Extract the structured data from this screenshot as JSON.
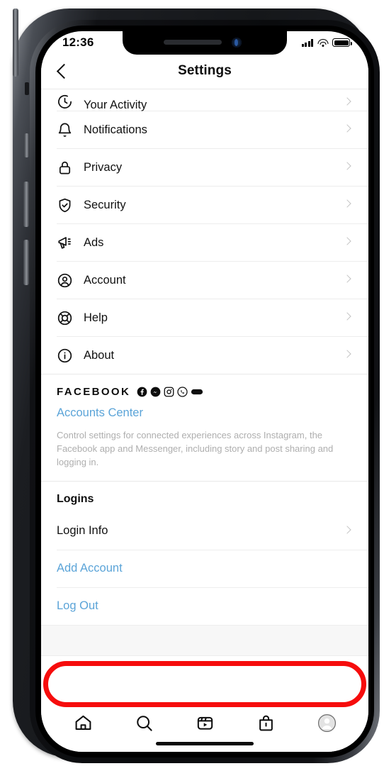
{
  "status_bar": {
    "time": "12:36",
    "signal_icon": "cellular-signal-icon",
    "wifi_icon": "wifi-icon",
    "battery_icon": "battery-icon"
  },
  "header": {
    "back_icon": "back-chevron-icon",
    "title": "Settings"
  },
  "settings_list": [
    {
      "label": "Your Activity",
      "icon": "activity-clock-icon",
      "chevron": true,
      "clipped": true
    },
    {
      "label": "Notifications",
      "icon": "bell-icon",
      "chevron": true
    },
    {
      "label": "Privacy",
      "icon": "lock-icon",
      "chevron": true
    },
    {
      "label": "Security",
      "icon": "shield-check-icon",
      "chevron": true
    },
    {
      "label": "Ads",
      "icon": "megaphone-icon",
      "chevron": true
    },
    {
      "label": "Account",
      "icon": "account-circle-icon",
      "chevron": true
    },
    {
      "label": "Help",
      "icon": "lifebuoy-icon",
      "chevron": true
    },
    {
      "label": "About",
      "icon": "info-circle-icon",
      "chevron": true
    }
  ],
  "facebook_section": {
    "heading": "FACEBOOK",
    "app_icons": [
      "facebook-icon",
      "messenger-icon",
      "instagram-icon",
      "whatsapp-icon",
      "portal-icon"
    ],
    "link_label": "Accounts Center",
    "description": "Control settings for connected experiences across Instagram, the Facebook app and Messenger, including story and post sharing and logging in."
  },
  "logins_section": {
    "heading": "Logins",
    "items": [
      {
        "label": "Login Info",
        "style": "default",
        "chevron": true,
        "highlighted": false
      },
      {
        "label": "Add Account",
        "style": "link",
        "chevron": false,
        "highlighted": true
      },
      {
        "label": "Log Out",
        "style": "link",
        "chevron": false,
        "highlighted": false
      }
    ]
  },
  "tab_bar": [
    {
      "name": "home-tab",
      "icon": "home-icon"
    },
    {
      "name": "search-tab",
      "icon": "search-icon"
    },
    {
      "name": "reels-tab",
      "icon": "reels-icon"
    },
    {
      "name": "shop-tab",
      "icon": "shopping-bag-icon"
    },
    {
      "name": "profile-tab",
      "icon": "avatar-icon"
    }
  ],
  "colors": {
    "link_blue": "#5ba4d8",
    "highlight_red": "#f60c0c",
    "text_primary": "#111111",
    "muted_text": "#aeaeae",
    "divider": "#e9e9e9"
  }
}
